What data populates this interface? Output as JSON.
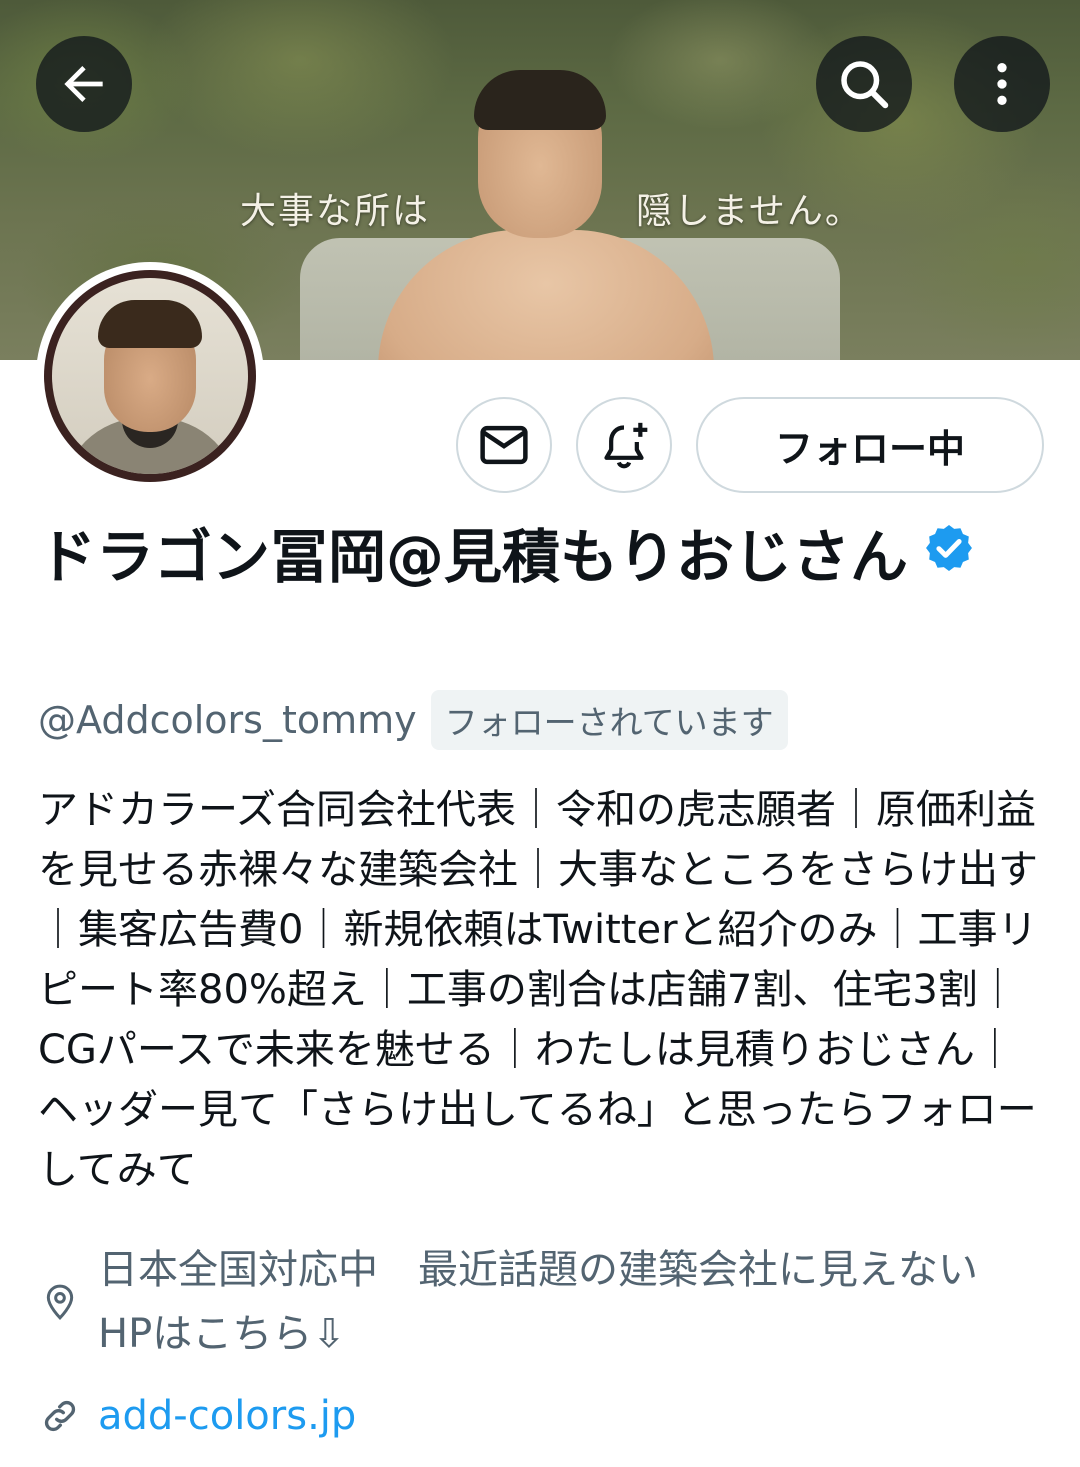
{
  "header": {
    "banner_text_left": "大事な所は",
    "banner_text_right": "隠しません。"
  },
  "nav": {
    "back_icon": "arrow-left-icon",
    "search_icon": "search-icon",
    "more_icon": "more-vertical-icon"
  },
  "actions": {
    "message_icon": "envelope-icon",
    "notify_icon": "bell-plus-icon",
    "follow_label": "フォロー中"
  },
  "profile": {
    "display_name": "ドラゴン冨岡@見積もりおじさん",
    "verified": true,
    "handle": "@Addcolors_tommy",
    "follows_you": "フォローされています",
    "bio": "アドカラーズ合同会社代表｜令和の虎志願者｜原価利益を見せる赤裸々な建築会社｜大事なところをさらけ出す｜集客広告費0｜新規依頼はTwitterと紹介のみ｜工事リピート率80%超え｜工事の割合は店舗7割、住宅3割｜CGパースで未来を魅せる｜わたしは見積りおじさん｜ヘッダー見て「さらけ出してるね」と思ったらフォローしてみて",
    "location": "日本全国対応中　最近話題の建築会社に見えないHPはこちら⇩",
    "website": "add-colors.jp"
  },
  "colors": {
    "accent": "#1d9bf0",
    "text_primary": "#0f1419",
    "text_secondary": "#536471",
    "border": "#cfd9de"
  }
}
